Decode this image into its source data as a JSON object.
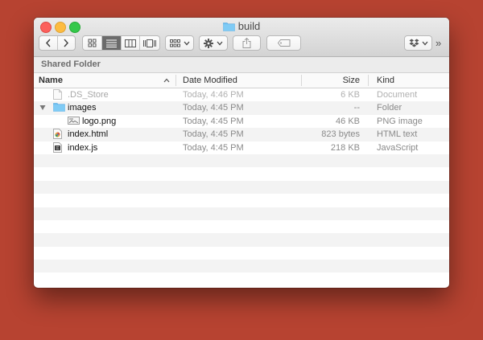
{
  "window": {
    "title": "build",
    "pathbar_label": "Shared Folder"
  },
  "toolbar": {
    "icons": [
      "chevron-left-icon",
      "chevron-right-icon",
      "icon-view-icon",
      "list-view-icon",
      "column-view-icon",
      "cover-flow-icon",
      "arrange-icon",
      "gear-icon",
      "share-icon",
      "tag-icon",
      "dropbox-icon",
      "overflow-icon"
    ],
    "selected_view": "list",
    "overflow_label": "»"
  },
  "columns": {
    "name": "Name",
    "date": "Date Modified",
    "size": "Size",
    "kind": "Kind"
  },
  "files": [
    {
      "name": ".DS_Store",
      "date": "Today, 4:46 PM",
      "size": "6 KB",
      "kind": "Document",
      "icon": "document-icon",
      "dim": true,
      "indent": 0
    },
    {
      "name": "images",
      "date": "Today, 4:45 PM",
      "size": "--",
      "kind": "Folder",
      "icon": "folder-icon",
      "dim": false,
      "indent": 0,
      "expanded": true
    },
    {
      "name": "logo.png",
      "date": "Today, 4:45 PM",
      "size": "46 KB",
      "kind": "PNG image",
      "icon": "image-icon",
      "dim": false,
      "indent": 1
    },
    {
      "name": "index.html",
      "date": "Today, 4:45 PM",
      "size": "823 bytes",
      "kind": "HTML text",
      "icon": "html-file-icon",
      "dim": false,
      "indent": 0
    },
    {
      "name": "index.js",
      "date": "Today, 4:45 PM",
      "size": "218 KB",
      "kind": "JavaScript",
      "icon": "js-file-icon",
      "dim": false,
      "indent": 0
    }
  ],
  "colors": {
    "desktop": "#b74331",
    "folder": "#6cbdf0"
  }
}
